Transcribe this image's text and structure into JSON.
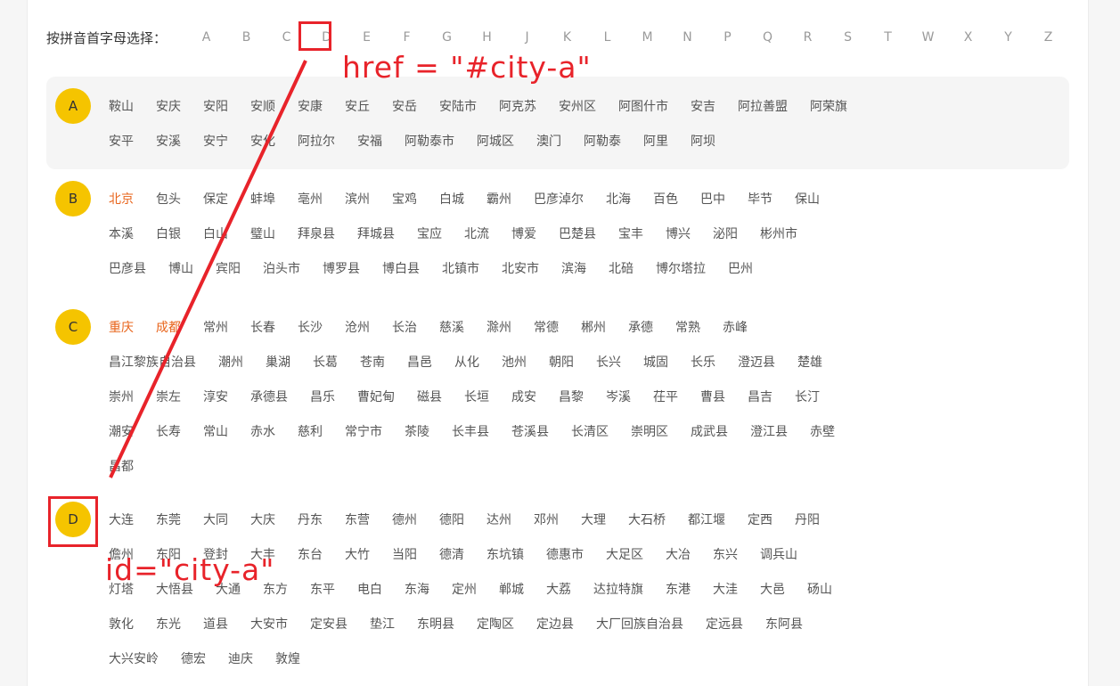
{
  "letter_bar": {
    "label": "按拼音首字母选择：",
    "letters": [
      "A",
      "B",
      "C",
      "D",
      "E",
      "F",
      "G",
      "H",
      "J",
      "K",
      "L",
      "M",
      "N",
      "P",
      "Q",
      "R",
      "S",
      "T",
      "W",
      "X",
      "Y",
      "Z"
    ]
  },
  "sections": [
    {
      "letter": "A",
      "rows": [
        [
          "鞍山",
          "安庆",
          "安阳",
          "安顺",
          "安康",
          "安丘",
          "安岳",
          "安陆市",
          "阿克苏",
          "安州区",
          "阿图什市",
          "安吉",
          "阿拉善盟",
          "阿荣旗"
        ],
        [
          "安平",
          "安溪",
          "安宁",
          "安化",
          "阿拉尔",
          "安福",
          "阿勒泰市",
          "阿城区",
          "澳门",
          "阿勒泰",
          "阿里",
          "阿坝"
        ]
      ]
    },
    {
      "letter": "B",
      "rows": [
        [
          "北京",
          "包头",
          "保定",
          "蚌埠",
          "亳州",
          "滨州",
          "宝鸡",
          "白城",
          "霸州",
          "巴彦淖尔",
          "北海",
          "百色",
          "巴中",
          "毕节",
          "保山"
        ],
        [
          "本溪",
          "白银",
          "白山",
          "璧山",
          "拜泉县",
          "拜城县",
          "宝应",
          "北流",
          "博爱",
          "巴楚县",
          "宝丰",
          "博兴",
          "泌阳",
          "彬州市"
        ],
        [
          "巴彦县",
          "博山",
          "宾阳",
          "泊头市",
          "博罗县",
          "博白县",
          "北镇市",
          "北安市",
          "滨海",
          "北碚",
          "博尔塔拉",
          "巴州"
        ]
      ]
    },
    {
      "letter": "C",
      "rows": [
        [
          "重庆",
          "成都",
          "常州",
          "长春",
          "长沙",
          "沧州",
          "长治",
          "慈溪",
          "滁州",
          "常德",
          "郴州",
          "承德",
          "常熟",
          "赤峰"
        ],
        [
          "昌江黎族自治县",
          "潮州",
          "巢湖",
          "长葛",
          "苍南",
          "昌邑",
          "从化",
          "池州",
          "朝阳",
          "长兴",
          "城固",
          "长乐",
          "澄迈县",
          "楚雄"
        ],
        [
          "崇州",
          "崇左",
          "淳安",
          "承德县",
          "昌乐",
          "曹妃甸",
          "磁县",
          "长垣",
          "成安",
          "昌黎",
          "岑溪",
          "茌平",
          "曹县",
          "昌吉",
          "长汀"
        ],
        [
          "潮安",
          "长寿",
          "常山",
          "赤水",
          "慈利",
          "常宁市",
          "茶陵",
          "长丰县",
          "苍溪县",
          "长清区",
          "崇明区",
          "成武县",
          "澄江县",
          "赤壁"
        ],
        [
          "昌都"
        ]
      ]
    },
    {
      "letter": "D",
      "rows": [
        [
          "大连",
          "东莞",
          "大同",
          "大庆",
          "丹东",
          "东营",
          "德州",
          "德阳",
          "达州",
          "邓州",
          "大理",
          "大石桥",
          "都江堰",
          "定西",
          "丹阳"
        ],
        [
          "儋州",
          "东阳",
          "登封",
          "大丰",
          "东台",
          "大竹",
          "当阳",
          "德清",
          "东坑镇",
          "德惠市",
          "大足区",
          "大冶",
          "东兴",
          "调兵山"
        ],
        [
          "灯塔",
          "大悟县",
          "大通",
          "东方",
          "东平",
          "电白",
          "东海",
          "定州",
          "郸城",
          "大荔",
          "达拉特旗",
          "东港",
          "大洼",
          "大邑",
          "砀山"
        ],
        [
          "敦化",
          "东光",
          "道县",
          "大安市",
          "定安县",
          "垫江",
          "东明县",
          "定陶区",
          "定边县",
          "大厂回族自治县",
          "定远县",
          "东阿县"
        ],
        [
          "大兴安岭",
          "德宏",
          "迪庆",
          "敦煌"
        ]
      ]
    }
  ],
  "hot_cities": [
    "北京",
    "重庆",
    "成都"
  ],
  "annotations": {
    "href_text": "href = \"#city-a\"",
    "id_text": "id=\"city-a\"",
    "color": "#e8232a"
  },
  "colors": {
    "badge": "#f5c400",
    "hot_city": "#e8641b",
    "shaded_section": "#f5f5f5"
  }
}
